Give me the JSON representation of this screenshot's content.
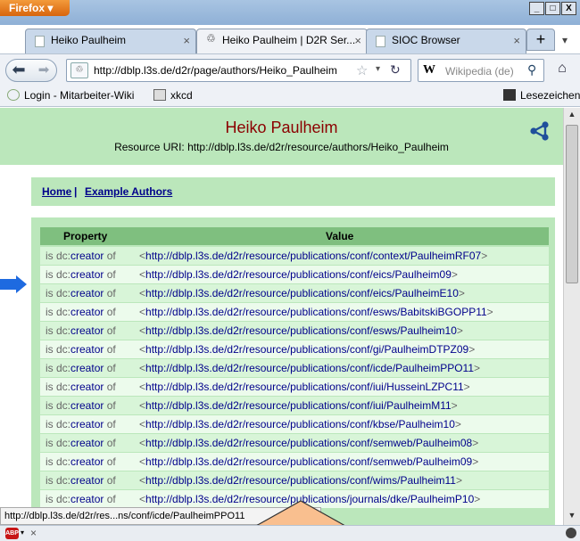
{
  "browser": {
    "menu_button": "Firefox",
    "window_controls": [
      "_",
      "□",
      "X"
    ],
    "tabs": [
      {
        "label": "Heiko Paulheim",
        "active": false
      },
      {
        "label": "Heiko Paulheim | D2R Ser...",
        "active": true
      },
      {
        "label": "SIOC Browser",
        "active": false
      }
    ],
    "new_tab": "+",
    "url": "http://dblp.l3s.de/d2r/page/authors/Heiko_Paulheim",
    "search_engine": "W",
    "search_placeholder": "Wikipedia (de)",
    "bookmarks": [
      {
        "label": "Login - Mitarbeiter-Wiki"
      },
      {
        "label": "xkcd"
      }
    ],
    "bookmarks_menu": "Lesezeichen",
    "status_url": "http://dblp.l3s.de/d2r/res...ns/conf/icde/PaulheimPPO11"
  },
  "page": {
    "title": "Heiko Paulheim",
    "resource_uri": "Resource URI: http://dblp.l3s.de/d2r/resource/authors/Heiko_Paulheim",
    "nav": {
      "home": "Home",
      "separator": "|",
      "examples": "Example Authors"
    },
    "table": {
      "headers": [
        "Property",
        "Value"
      ],
      "rows": [
        {
          "prefix": "is dc:",
          "property": "creator",
          "suffix": " of",
          "value": "http://dblp.l3s.de/d2r/resource/publications/conf/context/PaulheimRF07"
        },
        {
          "prefix": "is dc:",
          "property": "creator",
          "suffix": " of",
          "value": "http://dblp.l3s.de/d2r/resource/publications/conf/eics/Paulheim09"
        },
        {
          "prefix": "is dc:",
          "property": "creator",
          "suffix": " of",
          "value": "http://dblp.l3s.de/d2r/resource/publications/conf/eics/PaulheimE10"
        },
        {
          "prefix": "is dc:",
          "property": "creator",
          "suffix": " of",
          "value": "http://dblp.l3s.de/d2r/resource/publications/conf/esws/BabitskiBGOPP11"
        },
        {
          "prefix": "is dc:",
          "property": "creator",
          "suffix": " of",
          "value": "http://dblp.l3s.de/d2r/resource/publications/conf/esws/Paulheim10"
        },
        {
          "prefix": "is dc:",
          "property": "creator",
          "suffix": " of",
          "value": "http://dblp.l3s.de/d2r/resource/publications/conf/gi/PaulheimDTPZ09"
        },
        {
          "prefix": "is dc:",
          "property": "creator",
          "suffix": " of",
          "value": "http://dblp.l3s.de/d2r/resource/publications/conf/icde/PaulheimPPO11"
        },
        {
          "prefix": "is dc:",
          "property": "creator",
          "suffix": " of",
          "value": "http://dblp.l3s.de/d2r/resource/publications/conf/iui/HusseinLZPC11"
        },
        {
          "prefix": "is dc:",
          "property": "creator",
          "suffix": " of",
          "value": "http://dblp.l3s.de/d2r/resource/publications/conf/iui/PaulheimM11"
        },
        {
          "prefix": "is dc:",
          "property": "creator",
          "suffix": " of",
          "value": "http://dblp.l3s.de/d2r/resource/publications/conf/kbse/Paulheim10"
        },
        {
          "prefix": "is dc:",
          "property": "creator",
          "suffix": " of",
          "value": "http://dblp.l3s.de/d2r/resource/publications/conf/semweb/Paulheim08"
        },
        {
          "prefix": "is dc:",
          "property": "creator",
          "suffix": " of",
          "value": "http://dblp.l3s.de/d2r/resource/publications/conf/semweb/Paulheim09"
        },
        {
          "prefix": "is dc:",
          "property": "creator",
          "suffix": " of",
          "value": "http://dblp.l3s.de/d2r/resource/publications/conf/wims/Paulheim11"
        },
        {
          "prefix": "is dc:",
          "property": "creator",
          "suffix": " of",
          "value": "http://dblp.l3s.de/d2r/resource/publications/journals/dke/PaulheimP10"
        }
      ]
    }
  },
  "colors": {
    "header_bg": "#bbe7bb",
    "title": "#8b0000",
    "link": "#00008b",
    "table_header_bg": "#7fbf7f",
    "annotation_arrow": "#f9bf8f"
  }
}
